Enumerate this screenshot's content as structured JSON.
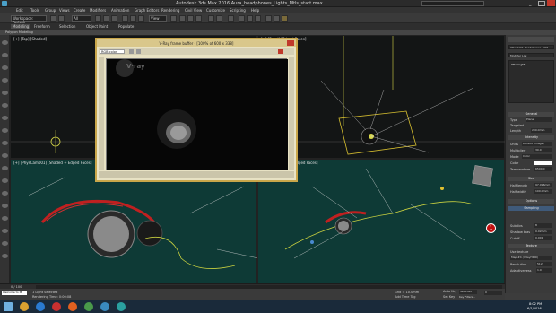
{
  "app": {
    "window_title": "Autodesk 3ds Max 2016     Aura_headphones_Lights_Mtls_start.max",
    "search_placeholder": "Type a keyword or phrase"
  },
  "menubar": {
    "items": [
      "Edit",
      "Tools",
      "Group",
      "Views",
      "Create",
      "Modifiers",
      "Animation",
      "Graph Editors",
      "Rendering",
      "Civil View",
      "Customize",
      "Scripting",
      "Help"
    ]
  },
  "toolbar": {
    "workspace": "Workspace: Default",
    "selection_filter": "All",
    "view_label": "View"
  },
  "ribbon": {
    "tabs": [
      "Modeling",
      "Freeform",
      "Selection",
      "Object Paint",
      "Populate"
    ],
    "sub_label": "Polygon Modeling"
  },
  "viewports": {
    "top_left_label": "[+] [Top] [Shaded]",
    "top_right_label": "[+] [Front] [Edged Faces]",
    "bottom_left_label": "[+] [PhysCam001] [Shaded + Edged Faces]",
    "bottom_right_label": "[+] [Perspective] [Edged Faces]"
  },
  "vray": {
    "title": "V-Ray frame buffer - [100% of 600 x 338]",
    "channel": "RGB color",
    "logo": "V·ray"
  },
  "right_panel": {
    "object_name": "VRaylight_headphones_pt01",
    "modifier_list": "Modifier List",
    "stack_item": "VRayLight",
    "sections": {
      "general": "General",
      "intensity": "Intensity",
      "size": "Size",
      "options": "Options",
      "sampling": "Sampling",
      "texture": "Texture"
    },
    "fields": {
      "on_label": "On",
      "type_label": "Type",
      "type_value": "Plane",
      "targeted_label": "Targeted",
      "length_label": "Length",
      "length_value": "200.0mm",
      "units_label": "Units",
      "units_value": "Default (image)",
      "multiplier_label": "Multiplier",
      "multiplier_value": "30.0",
      "mode_label": "Mode",
      "mode_value": "Color",
      "color_label": "Color",
      "temperature_label": "Temperature",
      "temperature_value": "6500.0",
      "half_length_label": "Half-length",
      "half_length_value": "97.096mm",
      "half_width_label": "Half-width",
      "half_width_value": "100.0mm",
      "subdivs_label": "Subdivs",
      "subdivs_value": "8",
      "shadow_bias_label": "Shadow bias",
      "shadow_bias_value": "0.02mm",
      "cutoff_label": "Cutoff",
      "cutoff_value": "0.001",
      "use_texture_label": "Use texture",
      "map_label": "Map #4 (VRayHDRI)",
      "resolution_label": "Resolution",
      "resolution_value": "512",
      "adaptiveness_label": "Adaptiveness",
      "adaptiveness_value": "1.0"
    }
  },
  "timeline": {
    "frame_range": "0 / 100",
    "ticks": [
      "0",
      "10",
      "20",
      "30",
      "40",
      "50",
      "60",
      "70",
      "80",
      "90",
      "100"
    ]
  },
  "status": {
    "selection": "1 Light Selected",
    "rendering_time": "Rendering Time: 0:00:08",
    "grid": "Grid = 10.0mm",
    "add_time_tag": "Add Time Tag",
    "autokey": "Auto Key",
    "selected": "Selected",
    "set_key": "Set Key",
    "key_filters": "Key Filters...",
    "welcome": "Welcome to M",
    "frame": "0"
  },
  "annotation": {
    "number": "1"
  },
  "taskbar": {
    "time": "8:02 PM",
    "date": "6/1/2016"
  },
  "colors": {
    "accent_orange": "#c9a64a",
    "viewport_teal": "#0e3a36",
    "viewport_dark": "#131515",
    "annotation_red": "#c01010",
    "wire_yellow": "#d8d84a",
    "wire_red": "#c02020"
  }
}
